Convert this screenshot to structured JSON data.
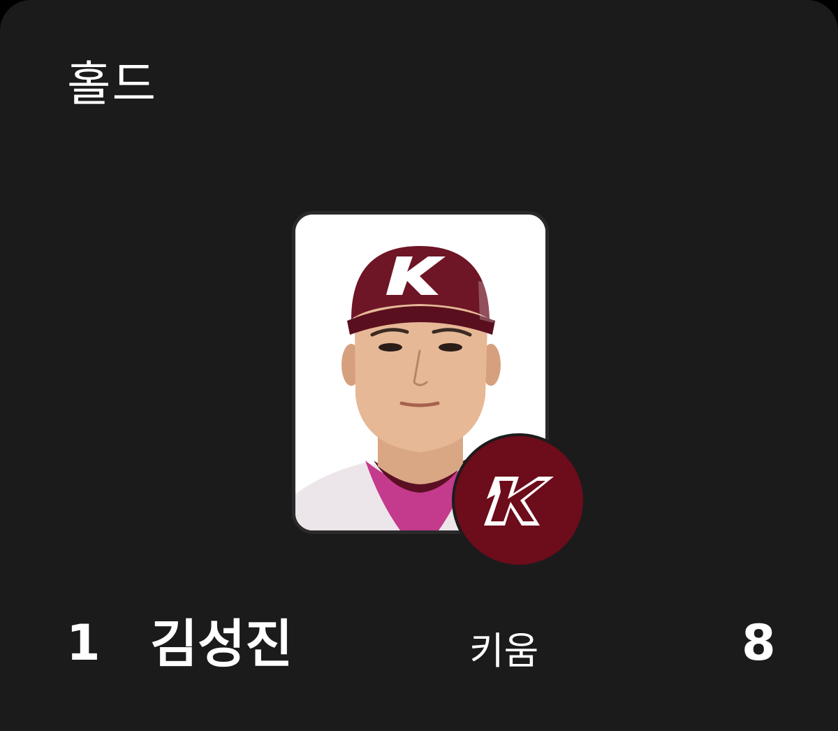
{
  "card": {
    "title": "홀드"
  },
  "player": {
    "rank": "1",
    "name": "김성진",
    "team": "키움",
    "value": "8"
  },
  "colors": {
    "background": "#1c1b1c",
    "team_accent": "#6d0c1a",
    "text": "#ffffff"
  },
  "icons": {
    "team_logo": "kiwoom-heroes-k-logo",
    "cap_logo": "k-letter"
  }
}
